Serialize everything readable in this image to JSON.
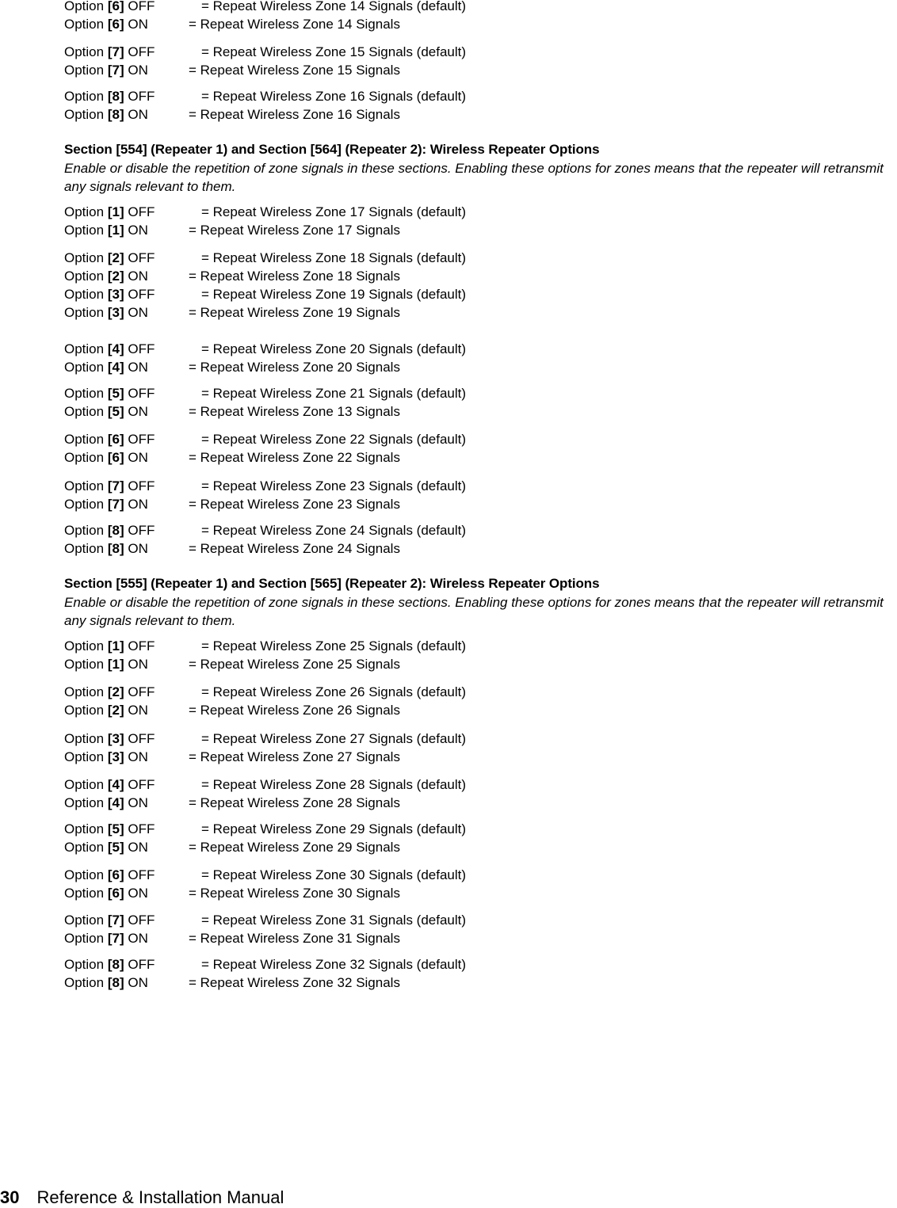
{
  "top_options": [
    {
      "num": "6",
      "state": "OFF",
      "desc": "= Repeat Wireless Zone 14 Signals (default)"
    },
    {
      "num": "6",
      "state": "ON",
      "desc": "= Repeat Wireless Zone 14 Signals"
    },
    {
      "num": "7",
      "state": "OFF",
      "desc": "= Repeat Wireless Zone 15 Signals (default)"
    },
    {
      "num": "7",
      "state": "ON",
      "desc": "= Repeat Wireless Zone 15 Signals"
    },
    {
      "num": "8",
      "state": "OFF",
      "desc": "= Repeat Wireless Zone 16 Signals (default)"
    },
    {
      "num": "8",
      "state": "ON",
      "desc": "= Repeat Wireless Zone 16 Signals"
    }
  ],
  "sections": [
    {
      "title": "Section [554] (Repeater 1) and Section [564] (Repeater 2): Wireless Repeater Options",
      "description": "Enable or disable the repetition of zone signals in these sections. Enabling these options for zones means that the repeater will retransmit any signals relevant to them.",
      "options": [
        {
          "num": "1",
          "state": "OFF",
          "desc": "= Repeat Wireless Zone 17 Signals (default)"
        },
        {
          "num": "1",
          "state": "ON",
          "desc": "= Repeat Wireless Zone 17 Signals"
        },
        {
          "num": "2",
          "state": "OFF",
          "desc": "= Repeat Wireless Zone 18 Signals (default)"
        },
        {
          "num": "2",
          "state": "ON",
          "desc": "= Repeat Wireless Zone 18 Signals"
        },
        {
          "num": "3",
          "state": "OFF",
          "desc": "= Repeat Wireless Zone 19 Signals (default)"
        },
        {
          "num": "3",
          "state": "ON",
          "desc": "= Repeat Wireless Zone 19 Signals"
        },
        {
          "num": "4",
          "state": "OFF",
          "desc": "= Repeat Wireless Zone 20 Signals (default)"
        },
        {
          "num": "4",
          "state": "ON",
          "desc": "= Repeat Wireless Zone 20 Signals"
        },
        {
          "num": "5",
          "state": "OFF",
          "desc": "= Repeat Wireless Zone 21 Signals (default)"
        },
        {
          "num": "5",
          "state": "ON",
          "desc": "= Repeat Wireless Zone 13 Signals"
        },
        {
          "num": "6",
          "state": "OFF",
          "desc": "= Repeat Wireless Zone 22 Signals (default)"
        },
        {
          "num": "6",
          "state": "ON",
          "desc": "= Repeat Wireless Zone 22 Signals"
        },
        {
          "num": "7",
          "state": "OFF",
          "desc": "= Repeat Wireless Zone 23 Signals (default)"
        },
        {
          "num": "7",
          "state": "ON",
          "desc": "= Repeat Wireless Zone 23 Signals"
        },
        {
          "num": "8",
          "state": "OFF",
          "desc": "= Repeat Wireless Zone 24 Signals (default)"
        },
        {
          "num": "8",
          "state": "ON",
          "desc": "= Repeat Wireless Zone 24 Signals"
        }
      ]
    },
    {
      "title": "Section [555] (Repeater 1) and Section [565] (Repeater 2): Wireless Repeater Options",
      "description": "Enable or disable the repetition of zone signals in these sections. Enabling these options for zones means that the repeater will retransmit any signals relevant to them.",
      "options": [
        {
          "num": "1",
          "state": "OFF",
          "desc": "= Repeat Wireless Zone 25 Signals (default)"
        },
        {
          "num": "1",
          "state": "ON",
          "desc": "= Repeat Wireless Zone 25 Signals"
        },
        {
          "num": "2",
          "state": "OFF",
          "desc": "= Repeat Wireless Zone 26 Signals (default)"
        },
        {
          "num": "2",
          "state": "ON",
          "desc": "= Repeat Wireless Zone 26 Signals"
        },
        {
          "num": "3",
          "state": "OFF",
          "desc": "= Repeat Wireless Zone 27 Signals (default)"
        },
        {
          "num": "3",
          "state": "ON",
          "desc": "= Repeat Wireless Zone 27 Signals"
        },
        {
          "num": "4",
          "state": "OFF",
          "desc": "= Repeat Wireless Zone 28 Signals (default)"
        },
        {
          "num": "4",
          "state": "ON",
          "desc": "= Repeat Wireless Zone 28 Signals"
        },
        {
          "num": "5",
          "state": "OFF",
          "desc": "= Repeat Wireless Zone 29 Signals (default)"
        },
        {
          "num": "5",
          "state": "ON",
          "desc": "= Repeat Wireless Zone 29 Signals"
        },
        {
          "num": "6",
          "state": "OFF",
          "desc": "= Repeat Wireless Zone 30 Signals (default)"
        },
        {
          "num": "6",
          "state": "ON",
          "desc": "= Repeat Wireless Zone 30 Signals"
        },
        {
          "num": "7",
          "state": "OFF",
          "desc": "= Repeat Wireless Zone 31 Signals (default)"
        },
        {
          "num": "7",
          "state": "ON",
          "desc": "= Repeat Wireless Zone 31 Signals"
        },
        {
          "num": "8",
          "state": "OFF",
          "desc": "= Repeat Wireless Zone 32 Signals (default)"
        },
        {
          "num": "8",
          "state": "ON",
          "desc": "= Repeat Wireless Zone 32 Signals"
        }
      ]
    }
  ],
  "labels": {
    "option_word": "Option"
  },
  "footer": {
    "page_number": "30",
    "manual_title": "Reference & Installation Manual"
  }
}
